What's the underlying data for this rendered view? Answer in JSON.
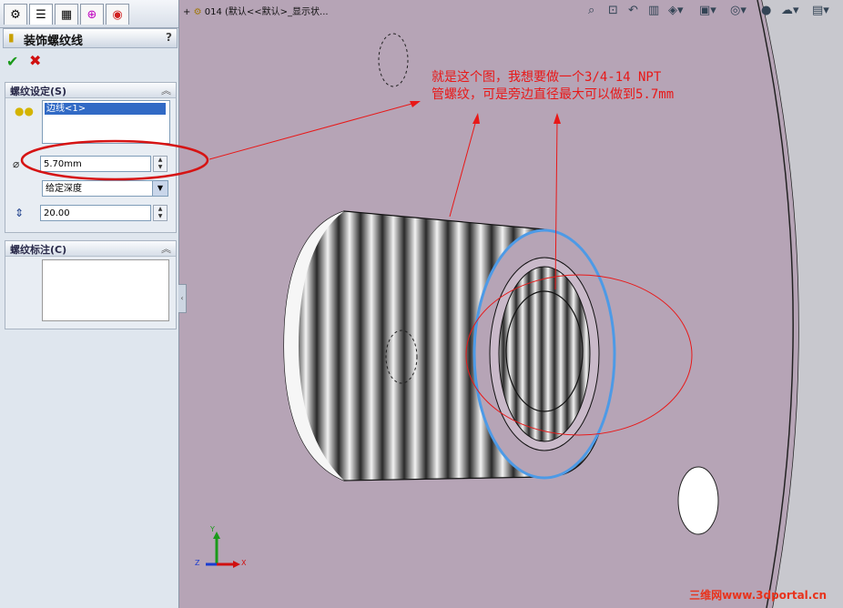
{
  "property_manager": {
    "title": "装饰螺纹线",
    "help": "?",
    "tabs": [
      "feature-manager-icon",
      "property-manager-icon",
      "configuration-manager-icon",
      "dimxpert-icon",
      "display-manager-icon"
    ],
    "ok": "✔",
    "cancel": "✖",
    "thread_settings": {
      "header": "螺纹设定(S)",
      "edge_selection": "边线<1>",
      "diameter": "5.70mm",
      "end_condition": "给定深度",
      "depth": "20.00"
    },
    "thread_callout": {
      "header": "螺纹标注(C)",
      "callout_text": ""
    }
  },
  "graphics": {
    "feature_tree_label": "014 (默认<<默认>_显示状...",
    "annotation_lines": [
      "就是这个图，我想要做一个3/4-14 NPT",
      "管螺纹，可是旁边直径最大可以做到5.7mm"
    ],
    "annotation_color": "#e81818",
    "background_color": "#b6a4b6",
    "triad": {
      "x": "X",
      "y": "Y",
      "z": "Z"
    },
    "watermark": "三维网www.3dportal.cn"
  }
}
